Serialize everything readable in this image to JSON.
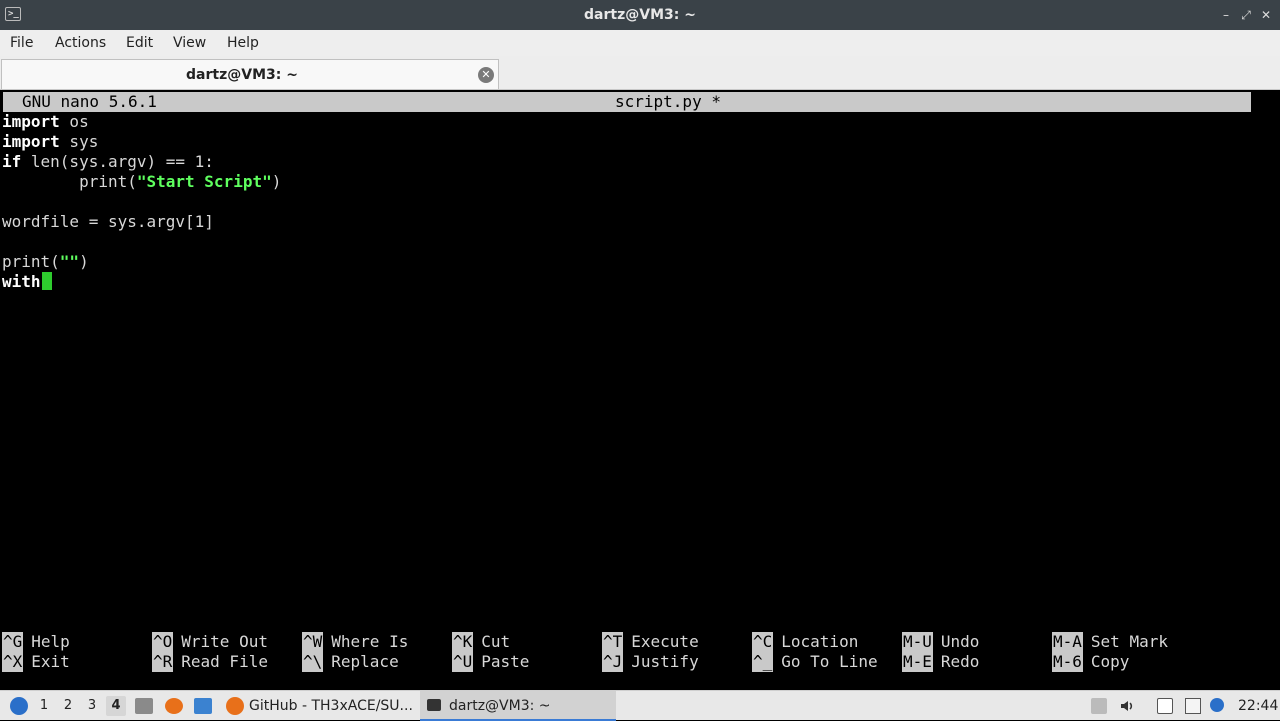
{
  "window": {
    "title": "dartz@VM3: ~",
    "app_icon": "terminal-icon",
    "controls": {
      "minimize": "–",
      "maximize": "⤢",
      "close": "✕"
    }
  },
  "menubar": {
    "items": [
      "File",
      "Actions",
      "Edit",
      "View",
      "Help"
    ]
  },
  "tabs": [
    {
      "label": "dartz@VM3: ~",
      "close_icon": "✕"
    }
  ],
  "nano": {
    "version": "GNU nano 5.6.1",
    "filename": "script.py *",
    "code_lines": [
      "import os",
      "import sys",
      "if len(sys.argv) == 1:",
      "        print(\"Start Script\")",
      "",
      "wordfile = sys.argv[1]",
      "",
      "print(\"\")",
      "with"
    ],
    "shortcuts": [
      {
        "key": "^G",
        "label": "Help"
      },
      {
        "key": "^O",
        "label": "Write Out"
      },
      {
        "key": "^W",
        "label": "Where Is"
      },
      {
        "key": "^K",
        "label": "Cut"
      },
      {
        "key": "^T",
        "label": "Execute"
      },
      {
        "key": "^C",
        "label": "Location"
      },
      {
        "key": "M-U",
        "label": "Undo"
      },
      {
        "key": "M-A",
        "label": "Set Mark"
      },
      {
        "key": "^X",
        "label": "Exit"
      },
      {
        "key": "^R",
        "label": "Read File"
      },
      {
        "key": "^\\",
        "label": "Replace"
      },
      {
        "key": "^U",
        "label": "Paste"
      },
      {
        "key": "^J",
        "label": "Justify"
      },
      {
        "key": "^_",
        "label": "Go To Line"
      },
      {
        "key": "M-E",
        "label": "Redo"
      },
      {
        "key": "M-6",
        "label": "Copy"
      }
    ]
  },
  "taskbar": {
    "workspaces": [
      "1",
      "2",
      "3",
      "4"
    ],
    "active_workspace": "4",
    "tasks": [
      {
        "label": "GitHub - TH3xACE/SU...",
        "icon": "firefox-icon"
      },
      {
        "label": "dartz@VM3: ~",
        "icon": "terminal-icon"
      }
    ],
    "clock": "22:44"
  },
  "colors": {
    "titlebar": "#3a4248",
    "nano_bar": "#c9c9c9",
    "string": "#5fff5f",
    "cursor": "#2ecc2e",
    "taskbar": "#e8e8e8"
  }
}
